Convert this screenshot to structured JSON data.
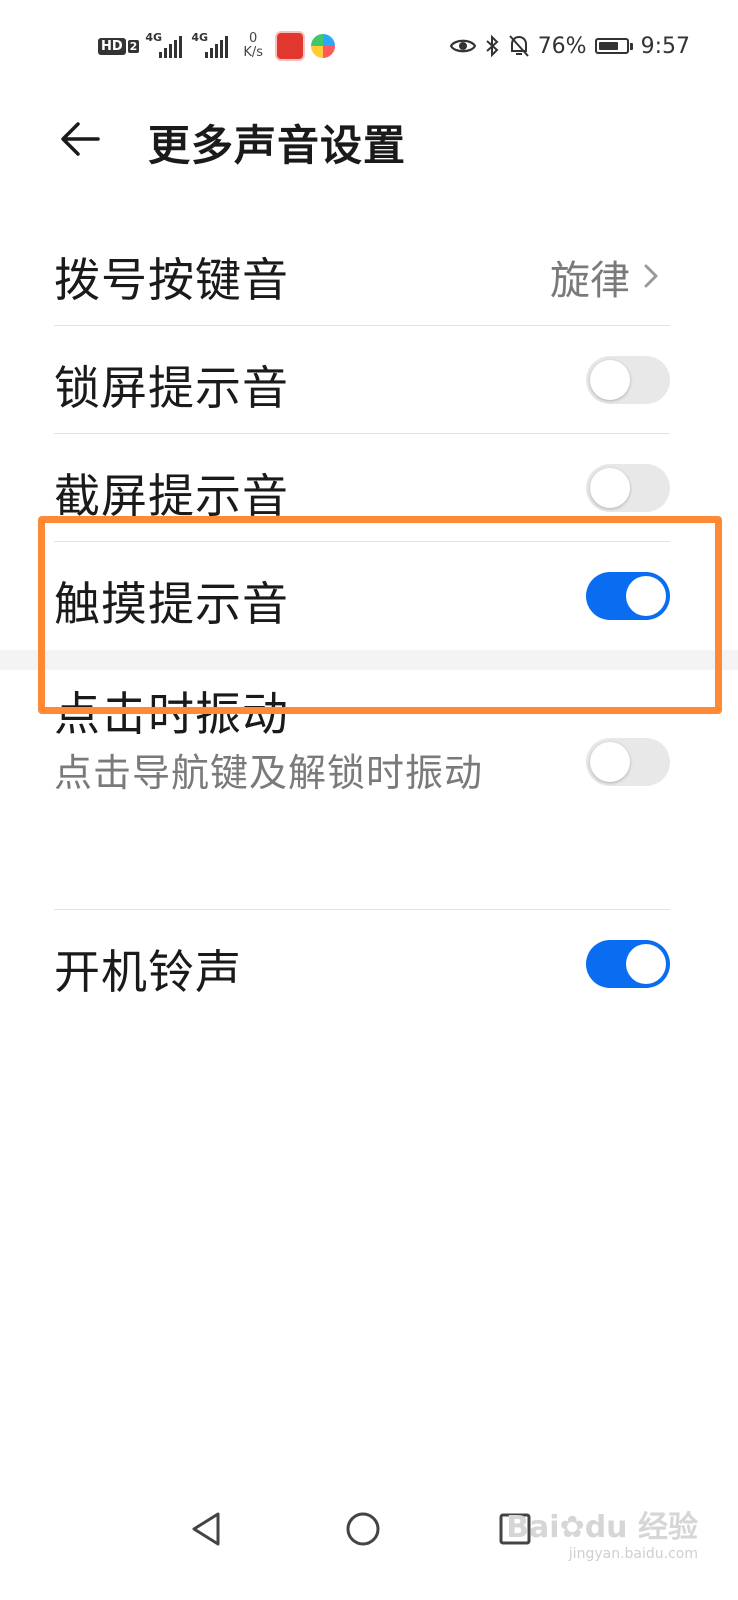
{
  "status_bar": {
    "hd_label": "HD",
    "hd_sim": "2",
    "sim1_tag": "4G",
    "sim2_tag": "4G",
    "speed_value": "0",
    "speed_unit": "K/s",
    "battery_percent": "76%",
    "battery_level": 0.76,
    "time": "9:57"
  },
  "header": {
    "title": "更多声音设置"
  },
  "settings": {
    "dial_tone": {
      "label": "拨号按键音",
      "value": "旋律"
    },
    "lock_sound": {
      "label": "锁屏提示音",
      "on": false
    },
    "screenshot_sound": {
      "label": "截屏提示音",
      "on": false
    },
    "touch_sound": {
      "label": "触摸提示音",
      "on": true
    },
    "tap_vibration": {
      "label": "点击时振动",
      "description": "点击导航键及解锁时振动",
      "on": false
    },
    "boot_ringtone": {
      "label": "开机铃声",
      "on": true
    }
  },
  "colors": {
    "toggle_on": "#0a6cf0",
    "toggle_off": "#e8e8e8",
    "highlight": "#ff8a35"
  },
  "watermark": {
    "brand": "Bai",
    "brand2": "du",
    "cn": "经验",
    "url": "jingyan.baidu.com"
  }
}
